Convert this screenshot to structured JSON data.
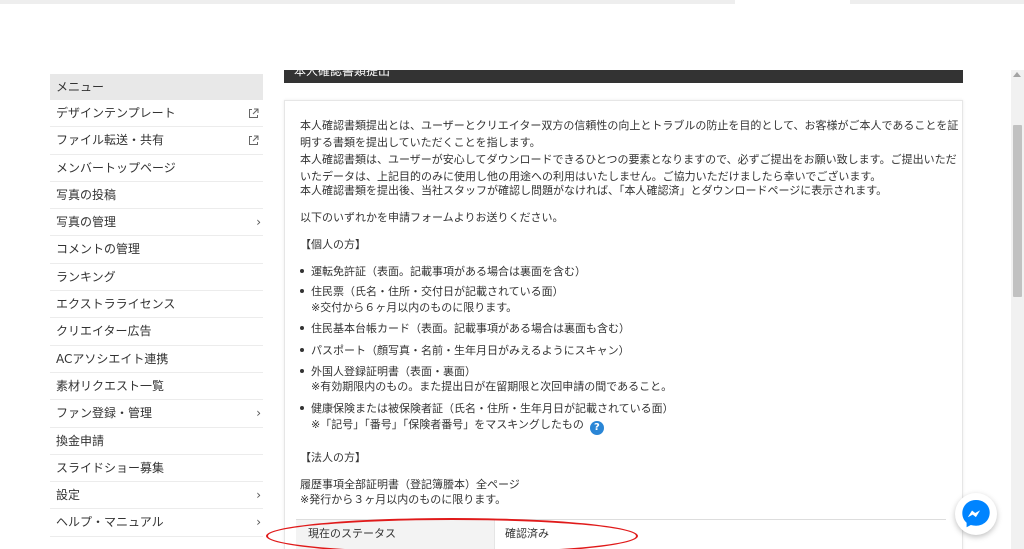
{
  "section": {
    "title": "本人確認書類提出"
  },
  "sidebar": {
    "menu_label": "メニュー",
    "items": [
      {
        "label": "デザインテンプレート",
        "marker": "external-link-icon"
      },
      {
        "label": "ファイル転送・共有",
        "marker": "external-link-icon"
      },
      {
        "label": "メンバートップページ",
        "marker": ""
      },
      {
        "label": "写真の投稿",
        "marker": ""
      },
      {
        "label": "写真の管理",
        "marker": "chevron-right-icon"
      },
      {
        "label": "コメントの管理",
        "marker": ""
      },
      {
        "label": "ランキング",
        "marker": ""
      },
      {
        "label": "エクストラライセンス",
        "marker": ""
      },
      {
        "label": "クリエイター広告",
        "marker": ""
      },
      {
        "label": "ACアソシエイト連携",
        "marker": ""
      },
      {
        "label": "素材リクエスト一覧",
        "marker": ""
      },
      {
        "label": "ファン登録・管理",
        "marker": "chevron-right-icon"
      },
      {
        "label": "換金申請",
        "marker": ""
      },
      {
        "label": "スライドショー募集",
        "marker": ""
      },
      {
        "label": "設定",
        "marker": "chevron-right-icon"
      },
      {
        "label": "ヘルプ・マニュアル",
        "marker": "chevron-right-icon"
      }
    ]
  },
  "main": {
    "intro": [
      "本人確認書類提出とは、ユーザーとクリエイター双方の信頼性の向上とトラブルの防止を目的として、お客様がご本人であることを証",
      "明する書類を提出していただくことを指します。",
      "本人確認書類は、ユーザーが安心してダウンロードできるひとつの要素となりますので、必ずご提出をお願い致します。ご提出いただ",
      "いたデータは、上記目的のみに使用し他の用途への利用はいたしません。ご協力いただけましたら幸いでございます。",
      "本人確認書類を提出後、当社スタッフが確認し問題がなければ、「本人確認済」とダウンロードページに表示されます。"
    ],
    "instruction": "以下のいずれかを申請フォームよりお送りください。",
    "individual_heading": "【個人の方】",
    "individual_items": [
      {
        "text": "運転免許証（表面。記載事項がある場合は裏面を含む）",
        "note": ""
      },
      {
        "text": "住民票（氏名・住所・交付日が記載されている面）",
        "note": "※交付から６ヶ月以内のものに限ります。"
      },
      {
        "text": "住民基本台帳カード（表面。記載事項がある場合は裏面も含む）",
        "note": ""
      },
      {
        "text": "パスポート（顔写真・名前・生年月日がみえるようにスキャン）",
        "note": ""
      },
      {
        "text": "外国人登録証明書（表面・裏面）",
        "note": "※有効期限内のもの。また提出日が在留期限と次回申請の間であること。"
      },
      {
        "text": "健康保険または被保険者証（氏名・住所・生年月日が記載されている面）",
        "note": "※「記号」「番号」「保険者番号」をマスキングしたもの"
      }
    ],
    "help_icon": "?",
    "corporate_heading": "【法人の方】",
    "corporate_lines": [
      "履歴事項全部証明書（登記簿謄本）全ページ",
      "※発行から３ヶ月以内のものに限ります。"
    ],
    "status": {
      "label": "現在のステータス",
      "value": "確認済み"
    }
  },
  "colors": {
    "highlight": "#e01a1a",
    "help": "#2a86d6",
    "messenger": "#0084ff"
  }
}
